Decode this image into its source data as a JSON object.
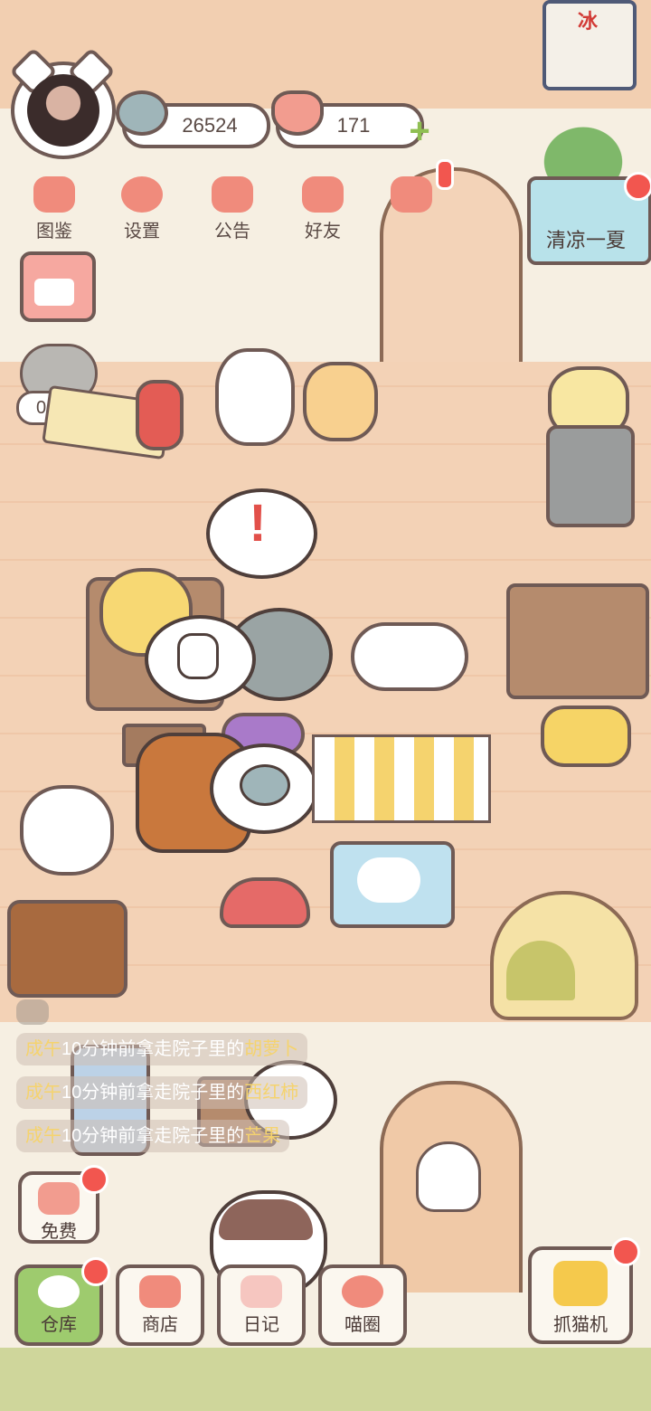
{
  "currency": {
    "fish_coins": "26524",
    "hearts": "171"
  },
  "top_menu": [
    {
      "label": "图鉴"
    },
    {
      "label": "设置"
    },
    {
      "label": "公告"
    },
    {
      "label": "好友"
    }
  ],
  "event_banner": {
    "label": "清凉一夏"
  },
  "shop_sign": {
    "label": "冰"
  },
  "visitor_timer": "04:33",
  "news": [
    {
      "who": "成午",
      "text": "10分钟前拿走院子里的",
      "item": "胡萝卜"
    },
    {
      "who": "成午",
      "text": "10分钟前拿走院子里的",
      "item": "西红柿"
    },
    {
      "who": "成午",
      "text": "10分钟前拿走院子里的",
      "item": "芒果"
    }
  ],
  "free_button": {
    "label": "免费"
  },
  "bottom_nav": [
    {
      "label": "仓库"
    },
    {
      "label": "商店"
    },
    {
      "label": "日记"
    },
    {
      "label": "喵圈"
    }
  ],
  "claw_machine": {
    "label": "抓猫机"
  },
  "alert_mark": "!",
  "colors": {
    "accent_red": "#f2564f",
    "outline": "#6f5a55",
    "floor": "#f3d2b6",
    "green_button": "#9ecb6e"
  }
}
